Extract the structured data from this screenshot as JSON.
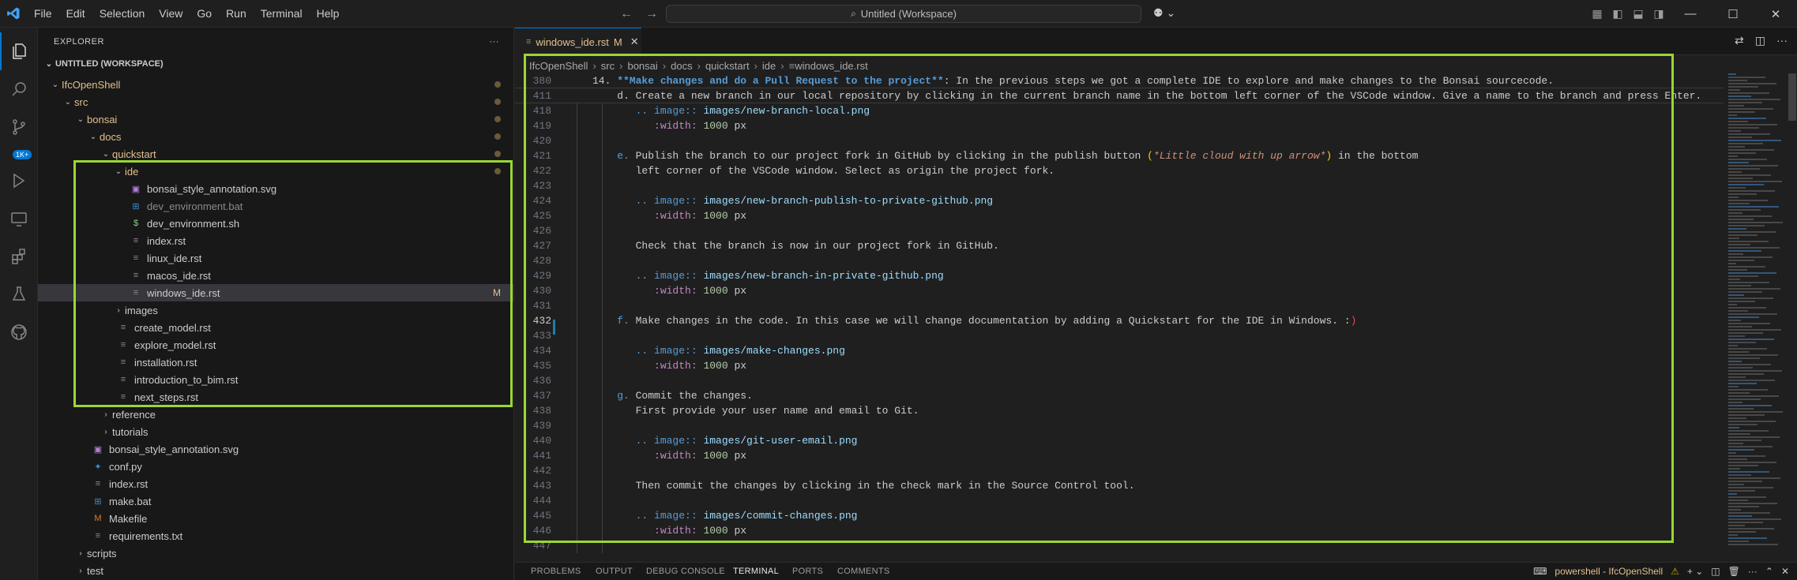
{
  "titlebar": {
    "menu": [
      "File",
      "Edit",
      "Selection",
      "View",
      "Go",
      "Run",
      "Terminal",
      "Help"
    ],
    "search_text": "Untitled (Workspace)"
  },
  "activity": {
    "scm_badge": "1K+"
  },
  "explorer": {
    "title": "EXPLORER",
    "more": "···",
    "workspace": "UNTITLED (WORKSPACE)",
    "tree": [
      {
        "label": "IfcOpenShell",
        "indent": 0,
        "chev": "⌄",
        "icon": "",
        "dot": true,
        "kind": "folder-mod"
      },
      {
        "label": "src",
        "indent": 1,
        "chev": "⌄",
        "icon": "",
        "dot": true,
        "kind": "folder-mod"
      },
      {
        "label": "bonsai",
        "indent": 2,
        "chev": "⌄",
        "icon": "",
        "dot": true,
        "kind": "folder-mod"
      },
      {
        "label": "docs",
        "indent": 3,
        "chev": "⌄",
        "icon": "",
        "dot": true,
        "kind": "folder-mod"
      },
      {
        "label": "quickstart",
        "indent": 4,
        "chev": "⌄",
        "icon": "",
        "dot": true,
        "kind": "folder-mod"
      },
      {
        "label": "ide",
        "indent": 5,
        "chev": "⌄",
        "icon": "",
        "dot": true,
        "kind": "folder-mod"
      },
      {
        "label": "bonsai_style_annotation.svg",
        "indent": 6,
        "chev": "",
        "icon": "svg",
        "kind": "file"
      },
      {
        "label": "dev_environment.bat",
        "indent": 6,
        "chev": "",
        "icon": "win",
        "kind": "dim"
      },
      {
        "label": "dev_environment.sh",
        "indent": 6,
        "chev": "",
        "icon": "sh",
        "kind": "file"
      },
      {
        "label": "index.rst",
        "indent": 6,
        "chev": "",
        "icon": "rst",
        "kind": "file"
      },
      {
        "label": "linux_ide.rst",
        "indent": 6,
        "chev": "",
        "icon": "rst",
        "kind": "file"
      },
      {
        "label": "macos_ide.rst",
        "indent": 6,
        "chev": "",
        "icon": "rst",
        "kind": "file"
      },
      {
        "label": "windows_ide.rst",
        "indent": 6,
        "chev": "",
        "icon": "rst",
        "kind": "selected",
        "mod": "M"
      },
      {
        "label": "images",
        "indent": 5,
        "chev": "›",
        "icon": "",
        "kind": "file"
      },
      {
        "label": "create_model.rst",
        "indent": 5,
        "chev": "",
        "icon": "rst",
        "kind": "file"
      },
      {
        "label": "explore_model.rst",
        "indent": 5,
        "chev": "",
        "icon": "rst",
        "kind": "file"
      },
      {
        "label": "installation.rst",
        "indent": 5,
        "chev": "",
        "icon": "rst",
        "kind": "file"
      },
      {
        "label": "introduction_to_bim.rst",
        "indent": 5,
        "chev": "",
        "icon": "rst",
        "kind": "file"
      },
      {
        "label": "next_steps.rst",
        "indent": 5,
        "chev": "",
        "icon": "rst",
        "kind": "file"
      },
      {
        "label": "reference",
        "indent": 4,
        "chev": "›",
        "icon": "",
        "kind": "file"
      },
      {
        "label": "tutorials",
        "indent": 4,
        "chev": "›",
        "icon": "",
        "kind": "file"
      },
      {
        "label": "bonsai_style_annotation.svg",
        "indent": 3,
        "chev": "",
        "icon": "svg",
        "kind": "file"
      },
      {
        "label": "conf.py",
        "indent": 3,
        "chev": "",
        "icon": "py",
        "kind": "file"
      },
      {
        "label": "index.rst",
        "indent": 3,
        "chev": "",
        "icon": "rst",
        "kind": "file"
      },
      {
        "label": "make.bat",
        "indent": 3,
        "chev": "",
        "icon": "win",
        "kind": "file"
      },
      {
        "label": "Makefile",
        "indent": 3,
        "chev": "",
        "icon": "make",
        "kind": "file"
      },
      {
        "label": "requirements.txt",
        "indent": 3,
        "chev": "",
        "icon": "rst",
        "kind": "file"
      },
      {
        "label": "scripts",
        "indent": 2,
        "chev": "›",
        "icon": "",
        "kind": "file"
      },
      {
        "label": "test",
        "indent": 2,
        "chev": "›",
        "icon": "",
        "kind": "file"
      }
    ]
  },
  "editor": {
    "tab_label": "windows_ide.rst",
    "tab_mod": "M",
    "breadcrumb": [
      "IfcOpenShell",
      "src",
      "bonsai",
      "docs",
      "quickstart",
      "ide",
      "windows_ide.rst"
    ],
    "lines": [
      {
        "n": "380",
        "sticky": true,
        "segs": [
          [
            "14. ",
            ""
          ],
          [
            "**Make changes and do a Pull Request to the project**",
            "bold"
          ],
          [
            ": In the previous steps we got a complete IDE to explore and make changes to the Bonsai sourcecode.",
            ""
          ]
        ]
      },
      {
        "n": "411",
        "sticky": true,
        "segs": [
          [
            "    d. Create a new branch in our local repository by clicking in the current branch name in the bottom left corner of the VSCode window. Give a name to the branch and press Enter.",
            ""
          ]
        ]
      },
      {
        "n": "418",
        "segs": [
          [
            "       ",
            ""
          ],
          [
            ".. image::",
            "dir"
          ],
          [
            " ",
            ""
          ],
          [
            "images/new-branch-local.png",
            "path"
          ]
        ]
      },
      {
        "n": "419",
        "segs": [
          [
            "          ",
            ""
          ],
          [
            ":width:",
            "opt"
          ],
          [
            " ",
            ""
          ],
          [
            "1000",
            "num"
          ],
          [
            " px",
            ""
          ]
        ]
      },
      {
        "n": "420",
        "segs": [
          [
            "",
            ""
          ]
        ]
      },
      {
        "n": "421",
        "segs": [
          [
            "    ",
            ""
          ],
          [
            "e.",
            "enum"
          ],
          [
            " Publish the branch to our project fork in GitHub by clicking in the publish button ",
            ""
          ],
          [
            "(",
            "paren"
          ],
          [
            "*Little cloud with up arrow*",
            "em"
          ],
          [
            ")",
            "paren"
          ],
          [
            " in the bottom",
            ""
          ]
        ]
      },
      {
        "n": "422",
        "segs": [
          [
            "       left corner of the VSCode window. Select as origin the project fork.",
            ""
          ]
        ]
      },
      {
        "n": "423",
        "segs": [
          [
            "",
            ""
          ]
        ]
      },
      {
        "n": "424",
        "segs": [
          [
            "       ",
            ""
          ],
          [
            ".. image::",
            "dir"
          ],
          [
            " ",
            ""
          ],
          [
            "images/new-branch-publish-to-private-github.png",
            "path"
          ]
        ]
      },
      {
        "n": "425",
        "segs": [
          [
            "          ",
            ""
          ],
          [
            ":width:",
            "opt"
          ],
          [
            " ",
            ""
          ],
          [
            "1000",
            "num"
          ],
          [
            " px",
            ""
          ]
        ]
      },
      {
        "n": "426",
        "segs": [
          [
            "",
            ""
          ]
        ]
      },
      {
        "n": "427",
        "segs": [
          [
            "       Check that the branch is now in our project fork in GitHub.",
            ""
          ]
        ]
      },
      {
        "n": "428",
        "segs": [
          [
            "",
            ""
          ]
        ]
      },
      {
        "n": "429",
        "segs": [
          [
            "       ",
            ""
          ],
          [
            ".. image::",
            "dir"
          ],
          [
            " ",
            ""
          ],
          [
            "images/new-branch-in-private-github.png",
            "path"
          ]
        ]
      },
      {
        "n": "430",
        "segs": [
          [
            "          ",
            ""
          ],
          [
            ":width:",
            "opt"
          ],
          [
            " ",
            ""
          ],
          [
            "1000",
            "num"
          ],
          [
            " px",
            ""
          ]
        ]
      },
      {
        "n": "431",
        "segs": [
          [
            "",
            ""
          ]
        ]
      },
      {
        "n": "432",
        "current": true,
        "segs": [
          [
            "    ",
            ""
          ],
          [
            "f.",
            "enum"
          ],
          [
            " Make changes in the code. In this case we will change documentation by adding a Quickstart for the IDE in Windows. :",
            ""
          ],
          [
            ")",
            "smile"
          ]
        ]
      },
      {
        "n": "433",
        "segs": [
          [
            "",
            ""
          ]
        ]
      },
      {
        "n": "434",
        "segs": [
          [
            "       ",
            ""
          ],
          [
            ".. image::",
            "dir"
          ],
          [
            " ",
            ""
          ],
          [
            "images/make-changes.png",
            "path"
          ]
        ]
      },
      {
        "n": "435",
        "segs": [
          [
            "          ",
            ""
          ],
          [
            ":width:",
            "opt"
          ],
          [
            " ",
            ""
          ],
          [
            "1000",
            "num"
          ],
          [
            " px",
            ""
          ]
        ]
      },
      {
        "n": "436",
        "segs": [
          [
            "",
            ""
          ]
        ]
      },
      {
        "n": "437",
        "segs": [
          [
            "    ",
            ""
          ],
          [
            "g.",
            "enum"
          ],
          [
            " Commit the changes.",
            ""
          ]
        ]
      },
      {
        "n": "438",
        "segs": [
          [
            "       First provide your user name and email to Git.",
            ""
          ]
        ]
      },
      {
        "n": "439",
        "segs": [
          [
            "",
            ""
          ]
        ]
      },
      {
        "n": "440",
        "segs": [
          [
            "       ",
            ""
          ],
          [
            ".. image::",
            "dir"
          ],
          [
            " ",
            ""
          ],
          [
            "images/git-user-email.png",
            "path"
          ]
        ]
      },
      {
        "n": "441",
        "segs": [
          [
            "          ",
            ""
          ],
          [
            ":width:",
            "opt"
          ],
          [
            " ",
            ""
          ],
          [
            "1000",
            "num"
          ],
          [
            " px",
            ""
          ]
        ]
      },
      {
        "n": "442",
        "segs": [
          [
            "",
            ""
          ]
        ]
      },
      {
        "n": "443",
        "segs": [
          [
            "       Then commit the changes by clicking in the check mark in the Source Control tool.",
            ""
          ]
        ]
      },
      {
        "n": "444",
        "segs": [
          [
            "",
            ""
          ]
        ]
      },
      {
        "n": "445",
        "segs": [
          [
            "       ",
            ""
          ],
          [
            ".. image::",
            "dir"
          ],
          [
            " ",
            ""
          ],
          [
            "images/commit-changes.png",
            "path"
          ]
        ]
      },
      {
        "n": "446",
        "segs": [
          [
            "          ",
            ""
          ],
          [
            ":width:",
            "opt"
          ],
          [
            " ",
            ""
          ],
          [
            "1000",
            "num"
          ],
          [
            " px",
            ""
          ]
        ]
      },
      {
        "n": "447",
        "segs": [
          [
            "",
            ""
          ]
        ]
      }
    ]
  },
  "panel": {
    "tabs": [
      "PROBLEMS",
      "OUTPUT",
      "DEBUG CONSOLE",
      "TERMINAL",
      "PORTS",
      "COMMENTS"
    ],
    "active": "TERMINAL",
    "terminal_name": "powershell - IfcOpenShell"
  },
  "colors": {
    "accent": "#0078d4",
    "highlight_box": "#9bd733",
    "modified": "#e2c08d"
  }
}
